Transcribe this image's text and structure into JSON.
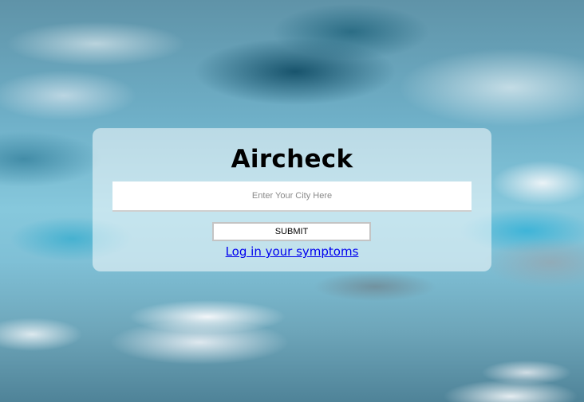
{
  "app": {
    "title": "Aircheck"
  },
  "search": {
    "placeholder": "Enter Your City Here",
    "value": ""
  },
  "actions": {
    "submit_label": "SUBMIT",
    "symptoms_link": "Log in your symptoms"
  },
  "background": {
    "description_icon": "sky-clouds-image"
  },
  "colors": {
    "link": "#0000ee",
    "card": "#ffffff",
    "title": "#000000"
  }
}
